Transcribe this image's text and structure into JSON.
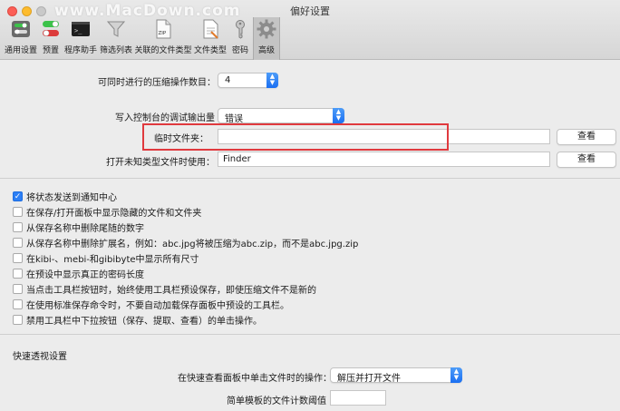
{
  "window": {
    "title": "偏好设置",
    "watermark": "www.MacDown.com"
  },
  "toolbar": {
    "items": [
      {
        "label": "通用设置",
        "icon": "switches-icon"
      },
      {
        "label": "预置",
        "icon": "toggle-icon"
      },
      {
        "label": "程序助手",
        "icon": "terminal-icon"
      },
      {
        "label": "筛选列表",
        "icon": "funnel-icon"
      },
      {
        "label": "关联的文件类型",
        "icon": "zip-file-icon"
      },
      {
        "label": "文件类型",
        "icon": "document-icon"
      },
      {
        "label": "密码",
        "icon": "key-icon"
      },
      {
        "label": "高级",
        "icon": "gear-icon"
      }
    ],
    "active_index": 7
  },
  "form": {
    "concurrent_label": "可同时进行的压缩操作数目：",
    "concurrent_value": "4",
    "console_label": "写入控制台的调试输出量",
    "console_value": "错误",
    "temp_label": "临时文件夹：",
    "temp_value": "",
    "view_button": "查看",
    "unknown_label": "打开未知类型文件时使用：",
    "unknown_value": "Finder",
    "view_button2": "查看"
  },
  "checkboxes": [
    {
      "label": "将状态发送到通知中心",
      "checked": true
    },
    {
      "label": "在保存/打开面板中显示隐藏的文件和文件夹",
      "checked": false
    },
    {
      "label": "从保存名称中删除尾随的数字",
      "checked": false
    },
    {
      "label": "从保存名称中删除扩展名，例如：abc.jpg将被压缩为abc.zip，而不是abc.jpg.zip",
      "checked": false
    },
    {
      "label": "在kibi-、mebi-和gibibyte中显示所有尺寸",
      "checked": false
    },
    {
      "label": "在预设中显示真正的密码长度",
      "checked": false
    },
    {
      "label": "当点击工具栏按钮时，始终使用工具栏预设保存，即使压缩文件不是新的",
      "checked": false
    },
    {
      "label": "在使用标准保存命令时，不要自动加载保存面板中预设的工具栏。",
      "checked": false
    },
    {
      "label": "禁用工具栏中下拉按钮（保存、提取、查看）的单击操作。",
      "checked": false
    }
  ],
  "quicklook": {
    "section_title": "快速透视设置",
    "click_label": "在快速查看面板中单击文件时的操作：",
    "click_value": "解压并打开文件",
    "threshold_label": "简单模板的文件计数阈值",
    "threshold_value": ""
  },
  "colors": {
    "accent": "#2d7ff5",
    "highlight": "#e03a3e"
  }
}
